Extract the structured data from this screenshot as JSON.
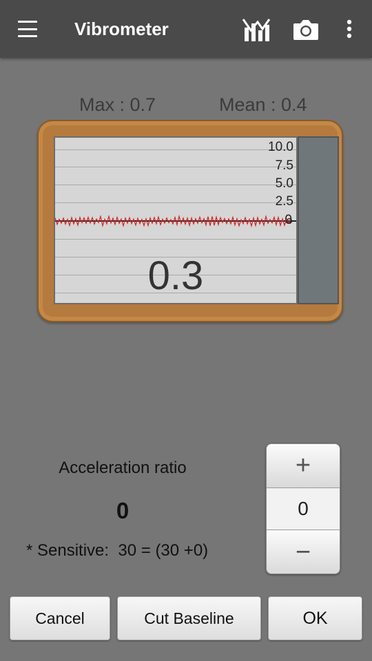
{
  "app_bar": {
    "title": "Vibrometer",
    "icons": [
      "menu-icon",
      "chart-icon",
      "camera-icon",
      "more-vert-icon"
    ]
  },
  "stats": {
    "max": "Max : 0.7",
    "mean": "Mean : 0.4"
  },
  "meter": {
    "scale_labels": [
      "10.0",
      "7.5",
      "5.0",
      "2.5",
      "0"
    ],
    "current_value": "0.3",
    "colors": {
      "frame": "#b57a3e",
      "graph_background": "#d6d6d6",
      "trace": "#d12a2a",
      "level_bar": "#6f777b"
    }
  },
  "acceleration": {
    "label": "Acceleration ratio",
    "value": "0",
    "sensitive_text": "* Sensitive:  30 = (30 +0)"
  },
  "stepper": {
    "plus_label": "+",
    "value": "0",
    "minus_label": "−"
  },
  "buttons": {
    "cancel": "Cancel",
    "cut_baseline": "Cut Baseline",
    "ok": "OK"
  }
}
